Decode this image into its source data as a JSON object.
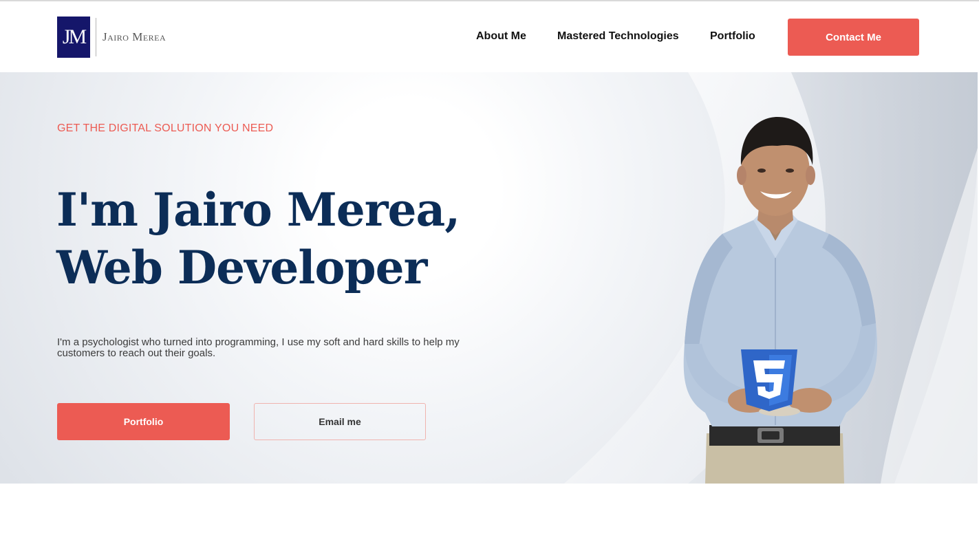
{
  "brand": {
    "monogram": "JM",
    "name": "Jairo Merea"
  },
  "nav": {
    "about": "About Me",
    "technologies": "Mastered Technologies",
    "portfolio": "Portfolio",
    "contact": "Contact Me"
  },
  "hero": {
    "eyebrow": "GET THE DIGITAL SOLUTION YOU NEED",
    "title_line1": "I'm Jairo Merea,",
    "title_line2": "Web Developer",
    "description": "I'm a psychologist who turned into programming, I use my soft and hard skills to help my customers to reach out their goals.",
    "primary_button": "Portfolio",
    "secondary_button": "Email me",
    "photo_icon": "person-holding-css3-badge",
    "badge_icon": "css3-icon"
  },
  "colors": {
    "accent": "#ec5b53",
    "heading": "#0c2d57",
    "logo_bg": "#15166a",
    "css3_blue": "#2f66c8"
  }
}
